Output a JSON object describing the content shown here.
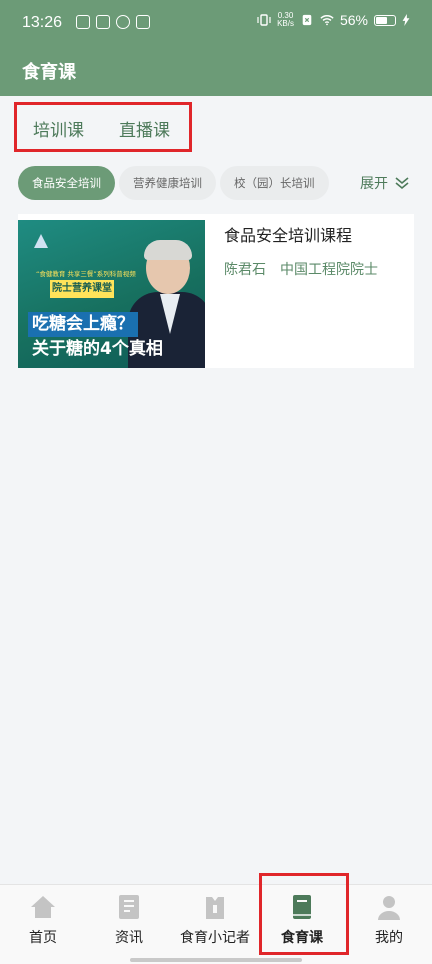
{
  "status_bar": {
    "time": "13:26",
    "net_speed_value": "0.30",
    "net_speed_unit": "KB/s",
    "battery": "56%"
  },
  "app_bar": {
    "title": "食育课"
  },
  "tabs": [
    {
      "label": "培训课",
      "selected": true
    },
    {
      "label": "直播课",
      "selected": false
    }
  ],
  "filter_chips": [
    {
      "label": "食品安全培训",
      "selected": true
    },
    {
      "label": "营养健康培训",
      "selected": false
    },
    {
      "label": "校（园）长培训",
      "selected": false
    }
  ],
  "expand_label": "展开",
  "course": {
    "title": "食品安全培训课程",
    "teacher": "陈君石　中国工程院院士",
    "thumbnail": {
      "tagline": "“食健教育 共享三餐”系列科普视频",
      "badge": "院士营养课堂",
      "headline_line1": "吃糖会上瘾？",
      "headline_line2": "关于糖的4个真相"
    }
  },
  "bottom_nav": [
    {
      "label": "首页",
      "icon": "home-icon",
      "active": false
    },
    {
      "label": "资讯",
      "icon": "news-icon",
      "active": false
    },
    {
      "label": "食育小记者",
      "icon": "reporter-icon",
      "active": false
    },
    {
      "label": "食育课",
      "icon": "book-icon",
      "active": true
    },
    {
      "label": "我的",
      "icon": "user-icon",
      "active": false
    }
  ],
  "colors": {
    "brand_green": "#6c9b77",
    "text_green": "#4d7a5a",
    "highlight_red": "#e0262a"
  }
}
